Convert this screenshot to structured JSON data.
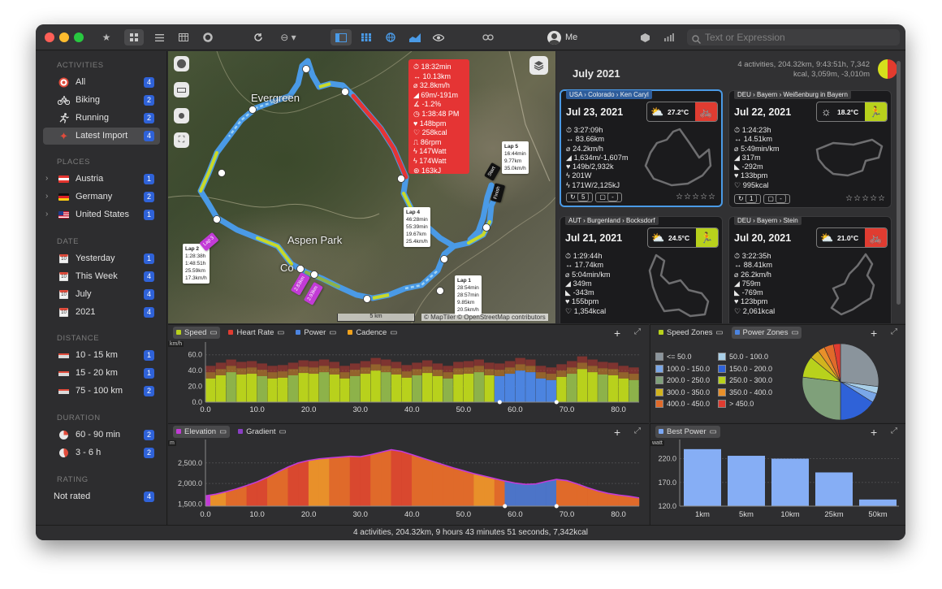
{
  "toolbar": {
    "user": "Me",
    "search_placeholder": "Text or Expression"
  },
  "sidebar": {
    "activities_header": "ACTIVITIES",
    "activities": [
      {
        "label": "All",
        "count": "4"
      },
      {
        "label": "Biking",
        "count": "2"
      },
      {
        "label": "Running",
        "count": "2"
      },
      {
        "label": "Latest Import",
        "count": "4"
      }
    ],
    "places_header": "PLACES",
    "places": [
      {
        "label": "Austria",
        "count": "1"
      },
      {
        "label": "Germany",
        "count": "2"
      },
      {
        "label": "United States",
        "count": "1"
      }
    ],
    "date_header": "DATE",
    "dates": [
      {
        "label": "Yesterday",
        "count": "1",
        "icon": "10"
      },
      {
        "label": "This Week",
        "count": "4",
        "icon": "10"
      },
      {
        "label": "July",
        "count": "4",
        "icon": "10"
      },
      {
        "label": "2021",
        "count": "4",
        "icon": "10"
      }
    ],
    "distance_header": "DISTANCE",
    "distances": [
      {
        "label": "10 - 15 km",
        "count": "1"
      },
      {
        "label": "15 - 20 km",
        "count": "1"
      },
      {
        "label": "75 - 100 km",
        "count": "2"
      }
    ],
    "duration_header": "DURATION",
    "durations": [
      {
        "label": "60 - 90 min",
        "count": "2"
      },
      {
        "label": "3 - 6 h",
        "count": "2"
      }
    ],
    "rating_header": "RATING",
    "ratings": [
      {
        "label": "Not rated",
        "count": "4"
      }
    ]
  },
  "map": {
    "place_labels": [
      "Evergreen",
      "Aspen Park",
      "Co"
    ],
    "attribution": "© MapTiler © OpenStreetMap contributors",
    "scale": "5 km",
    "start_label": "Start",
    "finish_label": "Finish",
    "tooltip": [
      "18:32min",
      "10.13km",
      "32.8km/h",
      "69m/-191m",
      "-1.2%",
      "1:38:48 PM",
      "148bpm",
      "258kcal",
      "86rpm",
      "147Watt",
      "174Watt",
      "163kJ"
    ],
    "laps": [
      {
        "name": "Lap 5",
        "lines": [
          "16:44min",
          "9.77km",
          "35.0km/h"
        ]
      },
      {
        "name": "Lap 4",
        "lines": [
          "46:28min",
          "55:39min",
          "19.67km",
          "25.4km/h"
        ]
      },
      {
        "name": "Lap 1",
        "lines": [
          "28:54min",
          "28:57min",
          "9.85km",
          "20.5km/h"
        ]
      },
      {
        "name": "Lap 2",
        "lines": [
          "1:28:38h",
          "1:48:51h",
          "25.59km",
          "17.3km/h"
        ]
      }
    ],
    "route_tags": [
      "Lap 3",
      "2.83km",
      "2.93km"
    ]
  },
  "summary": {
    "title": "July 2021",
    "line1": "4 activities, 204.32km, 9:43:51h, 7,342",
    "line2": "kcal, 3,059m, -3,010m"
  },
  "cards": [
    {
      "location": "USA › Colorado › Ken Caryl",
      "date": "Jul 23, 2021",
      "temp": "27.2°C",
      "stats": [
        "3:27:09h",
        "83.66km",
        "24.2km/h",
        "1,634m/-1,607m",
        "149b/2,932k",
        "201W",
        "171W/2,125kJ"
      ],
      "foot": [
        "5",
        "-"
      ],
      "stars": "☆☆☆☆☆"
    },
    {
      "location": "DEU › Bayern › Weißenburg in Bayern",
      "date": "Jul 22, 2021",
      "temp": "18.2°C",
      "stats": [
        "1:24:23h",
        "14.51km",
        "5:49min/km",
        "317m",
        "-292m",
        "133bpm",
        "995kcal"
      ],
      "foot": [
        "1",
        "-"
      ],
      "stars": "☆☆☆☆☆"
    },
    {
      "location": "AUT › Burgenland › Bocksdorf",
      "date": "Jul 21, 2021",
      "temp": "24.5°C",
      "stats": [
        "1:29:44h",
        "17.74km",
        "5:04min/km",
        "349m",
        "-343m",
        "155bpm",
        "1,354kcal"
      ]
    },
    {
      "location": "DEU › Bayern › Stein",
      "date": "Jul 20, 2021",
      "temp": "21.0°C",
      "stats": [
        "3:22:35h",
        "88.41km",
        "26.2km/h",
        "759m",
        "-769m",
        "123bpm",
        "2,061kcal"
      ]
    }
  ],
  "speed_panel": {
    "tabs": [
      {
        "label": "Speed",
        "color": "#b8d11c"
      },
      {
        "label": "Heart Rate",
        "color": "#e03c31"
      },
      {
        "label": "Power",
        "color": "#4c84e0"
      },
      {
        "label": "Cadence",
        "color": "#f0a21c"
      }
    ],
    "unit": "km/h"
  },
  "elevation_panel": {
    "tabs": [
      {
        "label": "Elevation",
        "color": "#c23bd6"
      },
      {
        "label": "Gradient",
        "color": "#8a3fc4"
      }
    ],
    "unit": "m"
  },
  "zones_panel": {
    "tabs": [
      {
        "label": "Speed Zones",
        "color": "#b8d11c"
      },
      {
        "label": "Power Zones",
        "color": "#4c84e0"
      }
    ],
    "zones": [
      {
        "label": "<= 50.0",
        "color": "#8a949c"
      },
      {
        "label": "50.0 - 100.0",
        "color": "#a9cfe8"
      },
      {
        "label": "100.0 - 150.0",
        "color": "#7aa7e8"
      },
      {
        "label": "150.0 - 200.0",
        "color": "#2f62d8"
      },
      {
        "label": "200.0 - 250.0",
        "color": "#7fa07a"
      },
      {
        "label": "250.0 - 300.0",
        "color": "#b8d11c"
      },
      {
        "label": "300.0 - 350.0",
        "color": "#d2b41e"
      },
      {
        "label": "350.0 - 400.0",
        "color": "#e8902a"
      },
      {
        "label": "400.0 - 450.0",
        "color": "#e06a2a"
      },
      {
        "label": "> 450.0",
        "color": "#e03c31"
      }
    ]
  },
  "best_power_panel": {
    "tabs": [
      {
        "label": "Best Power",
        "color": "#7aa7f5"
      }
    ],
    "unit": "watt"
  },
  "status": "4 activities, 204.32km, 9 hours 43 minutes 51 seconds, 7,342kcal",
  "chart_data": [
    {
      "type": "bar",
      "title": "Speed",
      "ylabel": "km/h",
      "xlim": [
        0,
        84
      ],
      "ylim": [
        0,
        70
      ],
      "x_ticks": [
        "0.0",
        "10.0",
        "20.0",
        "30.0",
        "40.0",
        "50.0",
        "60.0",
        "70.0",
        "80.0"
      ],
      "y_ticks": [
        "0.0",
        "20.0",
        "40.0",
        "60.0"
      ],
      "series": [
        {
          "name": "Speed",
          "x": [
            0,
            2,
            4,
            6,
            8,
            10,
            12,
            14,
            16,
            18,
            20,
            22,
            24,
            26,
            28,
            30,
            32,
            34,
            36,
            38,
            40,
            42,
            44,
            46,
            48,
            50,
            52,
            54,
            56,
            58,
            60,
            62,
            64,
            66,
            68,
            70,
            72,
            74,
            76,
            78,
            80,
            82
          ],
          "values": [
            30,
            34,
            38,
            35,
            36,
            33,
            30,
            31,
            34,
            37,
            36,
            38,
            35,
            30,
            33,
            36,
            40,
            38,
            35,
            31,
            34,
            37,
            33,
            30,
            35,
            36,
            38,
            34,
            33,
            36,
            40,
            38,
            30,
            28,
            32,
            36,
            42,
            38,
            35,
            34,
            30,
            28
          ]
        }
      ]
    },
    {
      "type": "area",
      "title": "Elevation",
      "ylabel": "m",
      "xlim": [
        0,
        84
      ],
      "ylim": [
        1450,
        2950
      ],
      "x_ticks": [
        "0.0",
        "10.0",
        "20.0",
        "30.0",
        "40.0",
        "50.0",
        "60.0",
        "70.0",
        "80.0"
      ],
      "y_ticks": [
        "1,500.0",
        "2,000.0",
        "2,500.0"
      ],
      "series": [
        {
          "name": "Elevation",
          "x": [
            0,
            2,
            4,
            6,
            8,
            10,
            12,
            14,
            16,
            18,
            20,
            22,
            24,
            26,
            28,
            30,
            32,
            34,
            36,
            38,
            40,
            42,
            44,
            46,
            48,
            50,
            52,
            54,
            56,
            58,
            60,
            62,
            64,
            66,
            68,
            70,
            72,
            74,
            76,
            78,
            80,
            82,
            84
          ],
          "values": [
            1700,
            1740,
            1800,
            1870,
            1950,
            2040,
            2150,
            2280,
            2400,
            2500,
            2560,
            2600,
            2620,
            2640,
            2660,
            2650,
            2700,
            2760,
            2820,
            2780,
            2700,
            2620,
            2540,
            2460,
            2380,
            2310,
            2240,
            2180,
            2120,
            2060,
            2010,
            1980,
            1990,
            2050,
            2100,
            2070,
            1990,
            1900,
            1820,
            1760,
            1720,
            1690,
            1650
          ]
        }
      ]
    },
    {
      "type": "pie",
      "title": "Power Zones",
      "categories": [
        "<= 50.0",
        "50.0 - 100.0",
        "100.0 - 150.0",
        "150.0 - 200.0",
        "200.0 - 250.0",
        "250.0 - 300.0",
        "300.0 - 350.0",
        "350.0 - 400.0",
        "400.0 - 450.0",
        "> 450.0"
      ],
      "values": [
        27,
        3,
        4,
        16,
        27,
        9,
        4,
        3,
        4,
        3
      ]
    },
    {
      "type": "bar",
      "title": "Best Power",
      "ylabel": "watt",
      "categories": [
        "1km",
        "5km",
        "10km",
        "25km",
        "50km"
      ],
      "values": [
        240,
        226,
        220,
        191,
        134
      ],
      "ylim": [
        120,
        250
      ],
      "y_ticks": [
        "120.0",
        "170.0",
        "220.0"
      ]
    }
  ]
}
